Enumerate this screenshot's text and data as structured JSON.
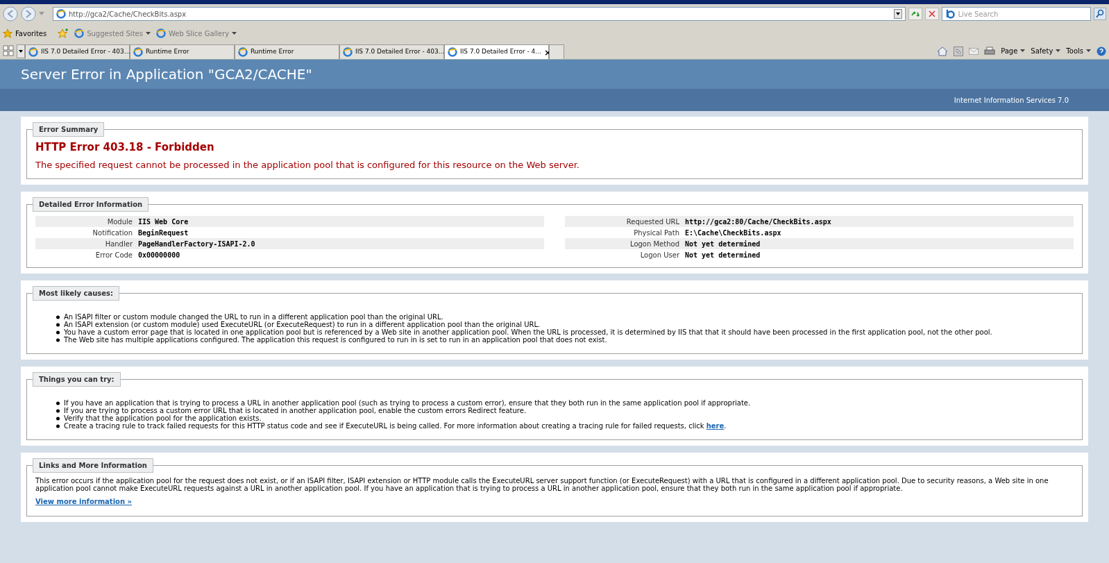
{
  "browser": {
    "address": "http://gca2/Cache/CheckBits.aspx",
    "search_placeholder": "Live Search",
    "favorites": {
      "label": "Favorites",
      "links": [
        "Suggested Sites",
        "Web Slice Gallery"
      ]
    },
    "tabs": [
      {
        "label": "IIS 7.0 Detailed Error - 403....",
        "selected": false
      },
      {
        "label": "Runtime Error",
        "selected": false
      },
      {
        "label": "Runtime Error",
        "selected": false
      },
      {
        "label": "IIS 7.0 Detailed Error - 403....",
        "selected": false
      },
      {
        "label": "IIS 7.0 Detailed Error - 4...",
        "selected": true
      }
    ],
    "close_glyph": "×",
    "commands": [
      "Page",
      "Safety",
      "Tools"
    ]
  },
  "page": {
    "title": "Server Error in Application \"GCA2/CACHE\"",
    "server": "Internet Information Services 7.0",
    "summary": {
      "legend": "Error Summary",
      "heading": "HTTP Error 403.18 - Forbidden",
      "message": "The specified request cannot be processed in the application pool that is configured for this resource on the Web server."
    },
    "details": {
      "legend": "Detailed Error Information",
      "left": [
        {
          "label": "Module",
          "value": "IIS Web Core"
        },
        {
          "label": "Notification",
          "value": "BeginRequest"
        },
        {
          "label": "Handler",
          "value": "PageHandlerFactory-ISAPI-2.0"
        },
        {
          "label": "Error Code",
          "value": "0x00000000"
        }
      ],
      "right": [
        {
          "label": "Requested URL",
          "value": "http://gca2:80/Cache/CheckBits.aspx"
        },
        {
          "label": "Physical Path",
          "value": "E:\\Cache\\CheckBits.aspx"
        },
        {
          "label": "Logon Method",
          "value": "Not yet determined"
        },
        {
          "label": "Logon User",
          "value": "Not yet determined"
        }
      ]
    },
    "causes": {
      "legend": "Most likely causes:",
      "items": [
        {
          "text": "An ISAPI filter or custom module changed the URL to run in a different application pool than the original URL."
        },
        {
          "text": "An ISAPI extension (or custom module) used ExecuteURL (or ExecuteRequest) to run in a different application pool than the original URL."
        },
        {
          "text": "You have a custom error page that is located in one application pool but is referenced by a Web site in another application pool. When the URL is processed, it is determined by IIS that that it should have been processed in the first application pool, not the other pool."
        },
        {
          "text": "The Web site has multiple applications configured. The application this request is configured to run in is set to run in an application pool that does not exist."
        }
      ]
    },
    "try": {
      "legend": "Things you can try:",
      "items": [
        {
          "text": "If you have an application that is trying to process a URL in another application pool (such as trying to process a custom error), ensure that they both run in the same application pool if appropriate."
        },
        {
          "text": "If you are trying to process a custom error URL that is located in another application pool, enable the custom errors Redirect feature."
        },
        {
          "text": "Verify that the application pool for the application exists."
        },
        {
          "text": "Create a tracing rule to track failed requests for this HTTP status code and see if ExecuteURL is being called. For more information about creating a tracing rule for failed requests, click",
          "link": "here",
          "after": "."
        }
      ]
    },
    "links": {
      "legend": "Links and More Information",
      "text": "This error occurs if the application pool for the request does not exist, or if an ISAPI filter, ISAPI extension or HTTP module calls the ExecuteURL server support function (or ExecuteRequest) with a URL that is configured in a different application pool. Due to security reasons, a Web site in one application pool cannot make ExecuteURL requests against a URL in another application pool. If you have an application that is trying to process a URL in another application pool, ensure that they both run in the same application pool if appropriate.",
      "more": "View more information »"
    }
  }
}
